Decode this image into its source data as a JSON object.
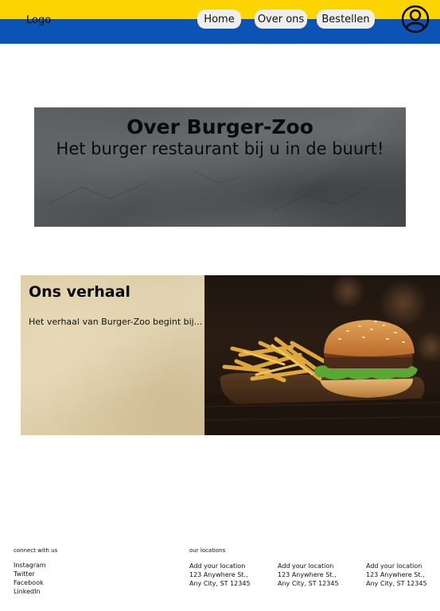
{
  "header": {
    "logo": "Logo",
    "nav": {
      "home": "Home",
      "about": "Over ons",
      "order": "Bestellen"
    },
    "account_icon": "user-circle-icon",
    "colors": {
      "top": "#fcd400",
      "bottom": "#0b53b4"
    }
  },
  "hero": {
    "title": "Over Burger-Zoo",
    "subtitle": "Het burger restaurant bij u in de buurt!"
  },
  "story": {
    "title": "Ons verhaal",
    "body": "Het verhaal van Burger-Zoo begint bij..."
  },
  "footer": {
    "connect_heading": "connect with us",
    "social": {
      "instagram": "Instagram",
      "twitter": "Twitter",
      "facebook": "Facebook",
      "linkedin": "LinkedIn"
    },
    "locations_heading": "our locations",
    "locations": [
      {
        "name": "Add your location",
        "street": "123 Anywhere St.,",
        "city": "Any City, ST 12345"
      },
      {
        "name": "Add your location",
        "street": "123 Anywhere St.,",
        "city": "Any City, ST 12345"
      },
      {
        "name": "Add your location",
        "street": "123 Anywhere St.,",
        "city": "Any City, ST 12345"
      }
    ]
  }
}
